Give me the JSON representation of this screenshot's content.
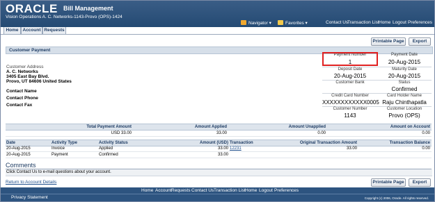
{
  "header": {
    "logo": "ORACLE",
    "app_name": "Bill Management",
    "org": "Vision Operations A. C. Networks-1143-Provo (OPS)-1424",
    "navigator": "Navigator ▾",
    "favorites": "Favorites ▾",
    "global_links": [
      "Contact Us",
      "Transaction List",
      "Home",
      "Logout",
      "Preferences"
    ]
  },
  "tabs": [
    "Home",
    "Account",
    "Requests"
  ],
  "buttons": {
    "printable": "Printable Page",
    "export": "Export"
  },
  "section_title": "Customer Payment",
  "address": {
    "label": "Customer Address",
    "line1": "A. C. Networks",
    "line2": "3405 East Bay Blvd.",
    "line3": "Provo, UT 84606 United States"
  },
  "contact": {
    "name": "Contact Name",
    "phone": "Contact Phone",
    "fax": "Contact Fax"
  },
  "details": [
    {
      "label": "Payment Number",
      "value": "1"
    },
    {
      "label": "Payment Date",
      "value": "20-Aug-2015"
    },
    {
      "label": "Deposit Date",
      "value": "20-Aug-2015"
    },
    {
      "label": "Maturity Date",
      "value": "20-Aug-2015"
    },
    {
      "label": "Customer Bank",
      "value": ""
    },
    {
      "label": "Status",
      "value": "Confirmed"
    },
    {
      "label": "Credit Card Number",
      "value": "XXXXXXXXXXXX0005"
    },
    {
      "label": "Card Holder Name",
      "value": "Raju Chinthapatla"
    },
    {
      "label": "Customer Number",
      "value": "1143"
    },
    {
      "label": "Customer Location",
      "value": "Provo (OPS)"
    }
  ],
  "summary": {
    "headers": [
      "Total Payment Amount",
      "Amount Applied",
      "Amount Unapplied",
      "Amount on Account"
    ],
    "values": [
      "USD 33.00",
      "33.00",
      "0.00",
      "0.00"
    ]
  },
  "activity": {
    "headers": [
      "Date",
      "Activity Type",
      "Activity Status",
      "Amount (USD)",
      "Transaction",
      "Original Transaction Amount",
      "Transaction Balance"
    ],
    "rows": [
      {
        "date": "20-Aug-2015",
        "type": "Invoice",
        "status": "Applied",
        "amount": "33.00",
        "transaction": "12231",
        "original": "33.00",
        "balance": "0.00"
      },
      {
        "date": "20-Aug-2015",
        "type": "Payment",
        "status": "Confirmed",
        "amount": "33.00",
        "transaction": "",
        "original": "",
        "balance": ""
      }
    ]
  },
  "comments": {
    "title": "Comments",
    "text": "Click Contact Us to e-mail questions about your account."
  },
  "return_link": "Return to Account Details",
  "footer": {
    "links": [
      "Home",
      "Account",
      "Requests",
      "Contact Us",
      "Transaction List",
      "Home",
      "Logout",
      "Preferences"
    ],
    "privacy": "Privacy Statement",
    "copyright": "Copyright (c) 2006, Oracle. All rights reserved."
  },
  "colors": {
    "header": "#2d5480",
    "highlight_box": "#e02020",
    "section_bar": "#d6dfe9"
  }
}
